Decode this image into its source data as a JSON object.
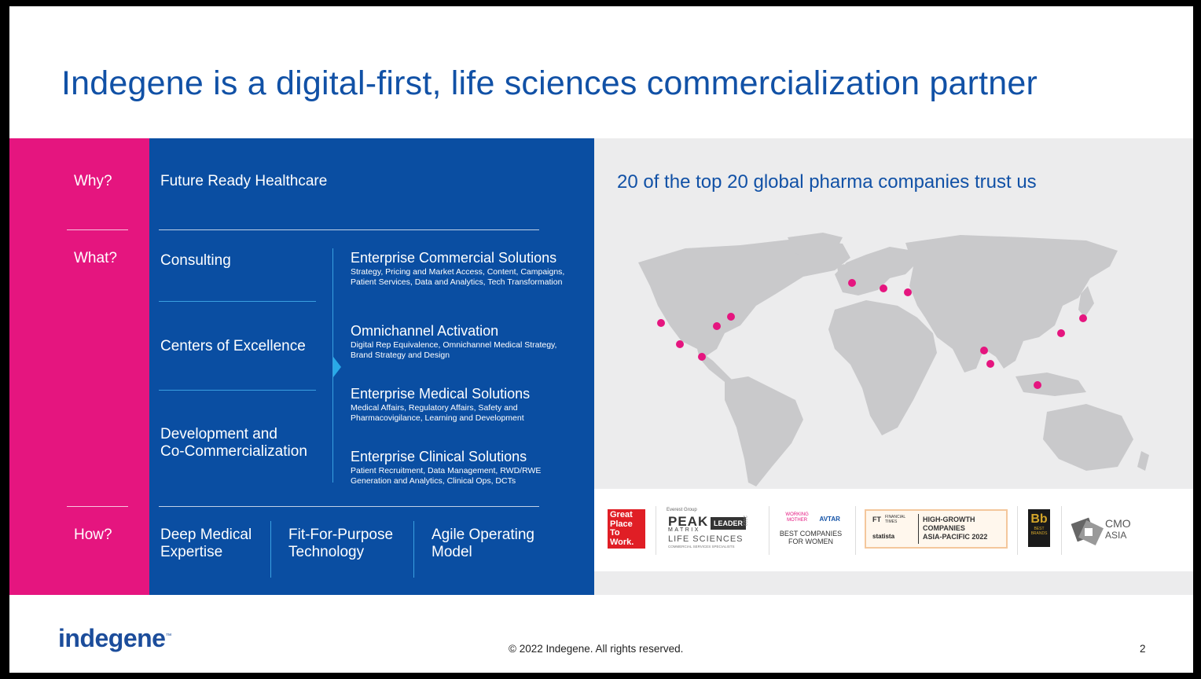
{
  "slide": {
    "title": "Indegene is a digital-first, life sciences commercialization partner",
    "page_number": "2",
    "copyright": "© 2022 Indegene. All rights reserved.",
    "logo_text": "indegene",
    "logo_tm": "™"
  },
  "left": {
    "why_label": "Why?",
    "why_text": "Future Ready Healthcare",
    "what_label": "What?",
    "what_items": [
      "Consulting",
      "Centers of Excellence",
      "Development and",
      "Co-Commercialization"
    ],
    "how_label": "How?",
    "how_items": [
      {
        "line1": "Deep  Medical",
        "line2": "Expertise"
      },
      {
        "line1": "Fit-For-Purpose",
        "line2": "Technology"
      },
      {
        "line1": "Agile Operating",
        "line2": "Model"
      }
    ],
    "solutions": [
      {
        "title": "Enterprise Commercial Solutions",
        "desc": "Strategy, Pricing and Market Access, Content, Campaigns, Patient Services, Data and Analytics, Tech Transformation"
      },
      {
        "title": "Omnichannel Activation",
        "desc": "Digital Rep Equivalence, Omnichannel Medical Strategy, Brand Strategy and Design"
      },
      {
        "title": "Enterprise Medical Solutions",
        "desc": "Medical Affairs, Regulatory Affairs, Safety and Pharmacovigilance, Learning and Development"
      },
      {
        "title": "Enterprise Clinical Solutions",
        "desc": "Patient Recruitment, Data Management, RWD/RWE Generation and Analytics, Clinical Ops, DCTs"
      }
    ]
  },
  "right": {
    "trust_text": "20 of the top 20 global pharma companies trust us",
    "awards": {
      "gptw": [
        "Great",
        "Place",
        "To",
        "Work."
      ],
      "peak": {
        "brand": "PEAK",
        "matrix": "MATRIX",
        "leader": "LEADER",
        "year": "2022",
        "sub": "LIFE SCIENCES",
        "tiny": "COMMERCIAL SERVICES SPECIALISTS",
        "top": "Everest Group"
      },
      "women": {
        "brand1": "WORKING MOTHER",
        "brand2": "AVTAR",
        "line1": "BEST COMPANIES",
        "line2": "FOR WOMEN"
      },
      "ft": {
        "ft": "FT",
        "ftname": "FINANCIAL TIMES",
        "statista": "statista",
        "line1": "HIGH-GROWTH",
        "line2": "COMPANIES",
        "line3": "ASIA-PACIFIC 2022"
      },
      "bb": {
        "mark": "Bb",
        "line1": "BEST",
        "line2": "BRANDS"
      },
      "cmo": {
        "line1": "CMO",
        "line2": "ASIA"
      }
    },
    "colors": {
      "pink": "#e5157f",
      "blue": "#0a4ea2",
      "title_blue": "#1151a6",
      "map_gray": "#c9c9cb"
    }
  }
}
